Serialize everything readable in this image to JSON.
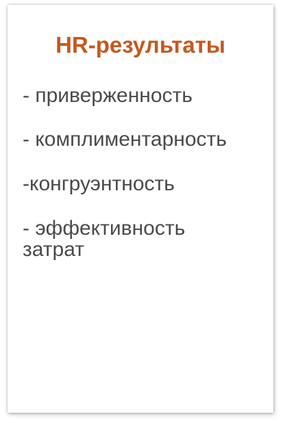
{
  "slide": {
    "title": "HR-результаты",
    "items": [
      "- приверженность",
      "- комплиментарность",
      "-конгруэнтность",
      "- эффективность затрат"
    ],
    "colors": {
      "title": "#c4591f",
      "text": "#4a4a4a"
    }
  }
}
